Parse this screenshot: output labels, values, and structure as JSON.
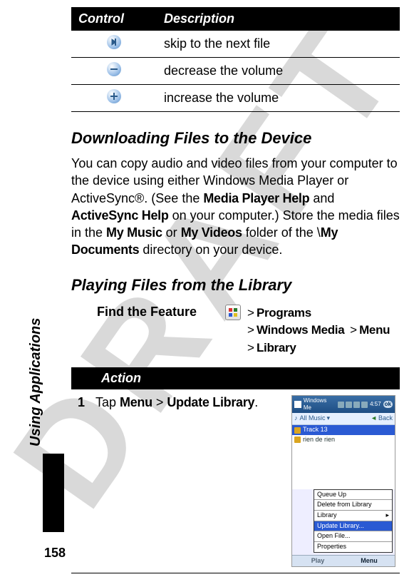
{
  "watermark": "DRAFT",
  "sidebar_label": "Using Applications",
  "page_number": "158",
  "control_table": {
    "headers": {
      "control": "Control",
      "description": "Description"
    },
    "rows": [
      {
        "icon": "skip-icon",
        "desc": "skip to the next file"
      },
      {
        "icon": "minus-icon",
        "desc": "decrease the volume"
      },
      {
        "icon": "plus-icon",
        "desc": "increase the volume"
      }
    ]
  },
  "section1": {
    "title": "Downloading Files to the Device",
    "para_a": "You can copy audio and video files from your computer to the device using either Windows Media Player or ActiveSync®. (See the ",
    "mph": "Media Player Help",
    "para_b": " and ",
    "ash": "ActiveSync Help",
    "para_c": " on your computer.) Store the media files in the ",
    "my_music": "My Music",
    "para_d": " or ",
    "my_videos": "My Videos",
    "para_e": " folder of the \\",
    "my_docs": "My Documents",
    "para_f": " directory on your device."
  },
  "section2": {
    "title": "Playing Files from the Library",
    "find_label": "Find the Feature",
    "path": {
      "programs": "Programs",
      "windows_media": "Windows Media",
      "menu": "Menu",
      "library": "Library"
    },
    "action_header": "Action",
    "step_num": "1",
    "step_a": "Tap ",
    "step_menu": "Menu",
    "step_gt": " > ",
    "step_update": "Update Library",
    "step_b": "."
  },
  "screenshot": {
    "title": "Windows Me",
    "time": "4:57",
    "ok": "ok",
    "toolbar": "All Music",
    "back": "Back",
    "item1": "Track 13",
    "item2": "rien de rien",
    "menu": {
      "queue": "Queue Up",
      "delete": "Delete from Library",
      "library": "Library",
      "update": "Update Library...",
      "open": "Open File...",
      "properties": "Properties"
    },
    "softkey_play": "Play",
    "softkey_menu": "Menu"
  }
}
